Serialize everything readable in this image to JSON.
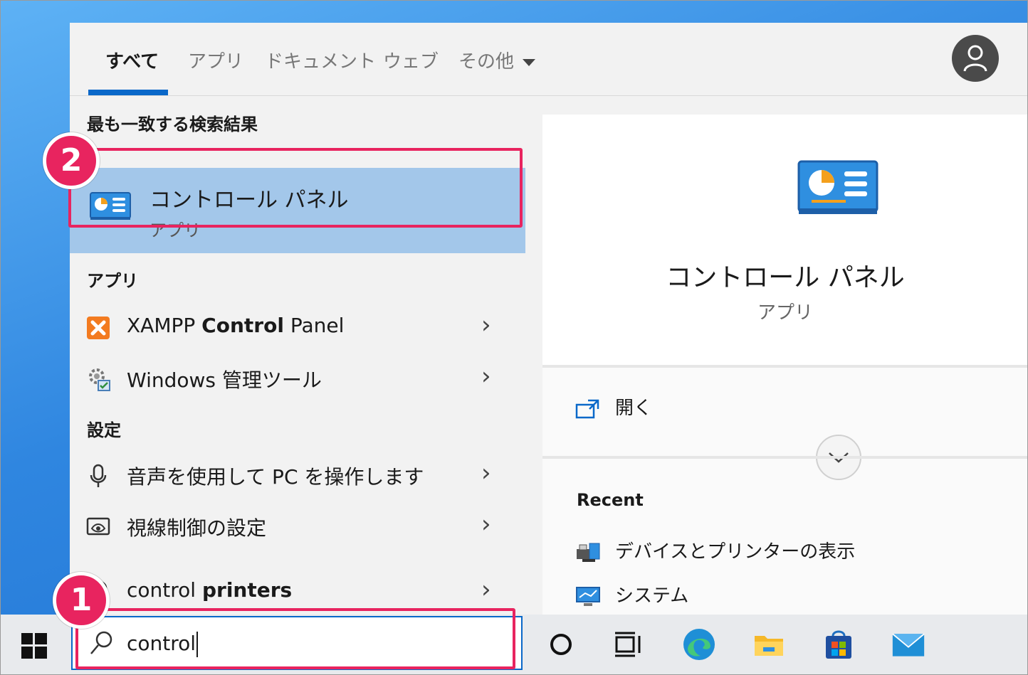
{
  "tabs": [
    "すべて",
    "アプリ",
    "ドキュメント",
    "ウェブ",
    "その他"
  ],
  "sections": {
    "best_match": "最も一致する検索結果",
    "apps": "アプリ",
    "settings": "設定"
  },
  "best_match": {
    "name": "コントロール パネル",
    "type": "アプリ"
  },
  "app_results": [
    {
      "label_prefix": "XAMPP ",
      "label_bold": "Control",
      "label_suffix": " Panel",
      "icon": "xampp-icon"
    },
    {
      "label_prefix": "Windows 管理ツール",
      "label_bold": "",
      "label_suffix": "",
      "icon": "admin-tools-icon"
    }
  ],
  "settings_results": [
    {
      "label": "音声を使用して PC を操作します",
      "icon": "microphone-icon"
    },
    {
      "label": "視線制御の設定",
      "icon": "eye-control-icon"
    }
  ],
  "web_result": {
    "label_prefix": "control ",
    "label_bold": "printers",
    "icon": "search-icon"
  },
  "preview": {
    "title": "コントロール パネル",
    "subtitle": "アプリ",
    "open_label": "開く",
    "recent_heading": "Recent",
    "recent": [
      {
        "label": "デバイスとプリンターの表示",
        "icon": "devices-printers-icon"
      },
      {
        "label": "システム",
        "icon": "system-monitor-icon"
      }
    ]
  },
  "search": {
    "query": "control"
  },
  "markers": {
    "one": "1",
    "two": "2"
  },
  "colors": {
    "accent": "#0a68c9",
    "highlight": "#e8245f",
    "selected": "#a3c7ea"
  }
}
